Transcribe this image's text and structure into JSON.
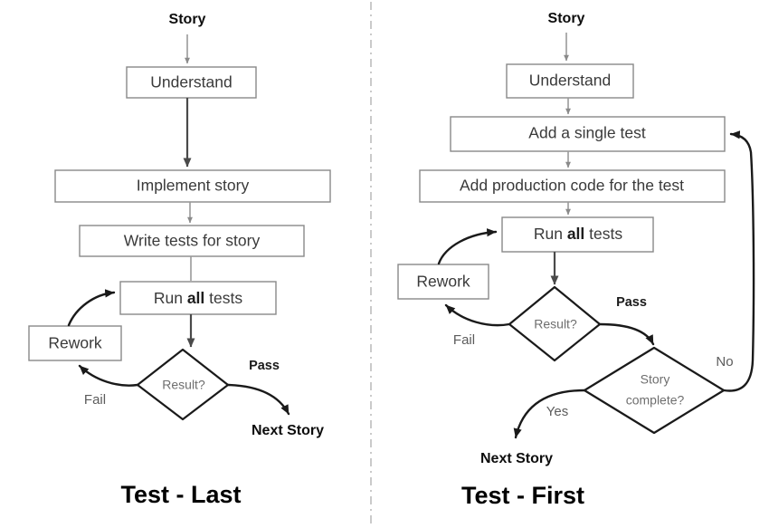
{
  "figure": {
    "kind": "flowchart-comparison",
    "background_color": "#ffffff",
    "divider": "vertical-dash-dot"
  },
  "panels": [
    {
      "id": "test-last",
      "title": "Test - Last",
      "start_label": "Story",
      "nodes": [
        {
          "id": "understand",
          "label": "Understand",
          "shape": "process"
        },
        {
          "id": "implement",
          "label": "Implement story",
          "shape": "process"
        },
        {
          "id": "write-tests",
          "label": "Write tests for story",
          "shape": "process"
        },
        {
          "id": "run-tests",
          "label_prefix": "Run ",
          "label_emphasis": "all",
          "label_suffix": " tests",
          "shape": "process"
        },
        {
          "id": "rework",
          "label": "Rework",
          "shape": "process"
        },
        {
          "id": "result",
          "label": "Result?",
          "shape": "decision"
        }
      ],
      "edge_labels": {
        "fail": "Fail",
        "pass": "Pass"
      },
      "end_label": "Next Story"
    },
    {
      "id": "test-first",
      "title": "Test - First",
      "start_label": "Story",
      "nodes": [
        {
          "id": "understand",
          "label": "Understand",
          "shape": "process"
        },
        {
          "id": "add-single-test",
          "label": "Add a single test",
          "shape": "process"
        },
        {
          "id": "add-production-code",
          "label": "Add production code for the test",
          "shape": "process"
        },
        {
          "id": "run-tests",
          "label_prefix": "Run ",
          "label_emphasis": "all",
          "label_suffix": " tests",
          "shape": "process"
        },
        {
          "id": "rework",
          "label": "Rework",
          "shape": "process"
        },
        {
          "id": "result",
          "label": "Result?",
          "shape": "decision"
        },
        {
          "id": "story-complete",
          "label_line1": "Story",
          "label_line2": "complete?",
          "shape": "decision"
        }
      ],
      "edge_labels": {
        "fail": "Fail",
        "pass": "Pass",
        "yes": "Yes",
        "no": "No"
      },
      "end_label": "Next Story"
    }
  ],
  "colors": {
    "box_stroke": "#888888",
    "diamond_stroke": "#1a1a1a",
    "connector": "#4a4a4a",
    "text": "#2b2b2b",
    "divider": "#bdbdbd"
  }
}
